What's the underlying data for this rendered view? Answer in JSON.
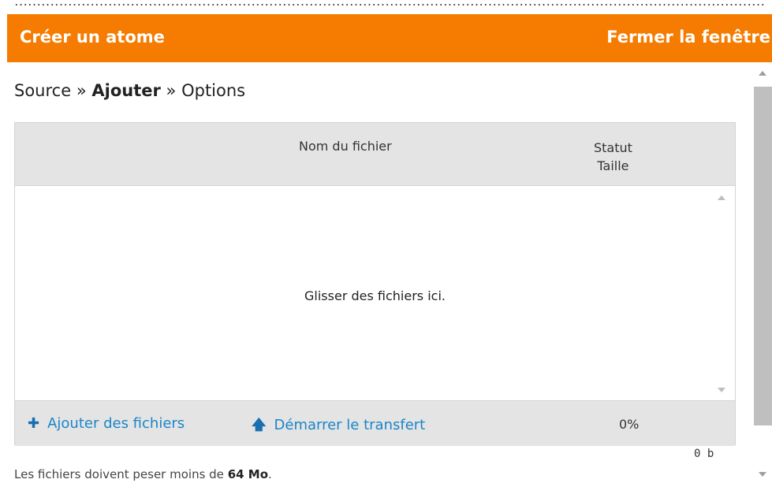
{
  "window": {
    "title": "Créer un atome",
    "close_label": "Fermer la fenêtre",
    "accent_color": "#f57c00"
  },
  "breadcrumb": {
    "step1": "Source",
    "sep": "»",
    "step2": "Ajouter",
    "step3": "Options"
  },
  "uploader": {
    "col_name": "Nom du fichier",
    "col_status": "Statut",
    "col_size": "Taille",
    "drop_message": "Glisser des fichiers ici.",
    "add_files_label": "Ajouter des fichiers",
    "start_upload_label": "Démarrer le transfert",
    "progress": "0%",
    "total_size": "0 b",
    "add_icon": "plus-icon",
    "start_icon": "arrow-up-icon"
  },
  "note": {
    "prefix": "Les fichiers doivent peser moins de",
    "limit": "64 Mo",
    "suffix": "."
  }
}
